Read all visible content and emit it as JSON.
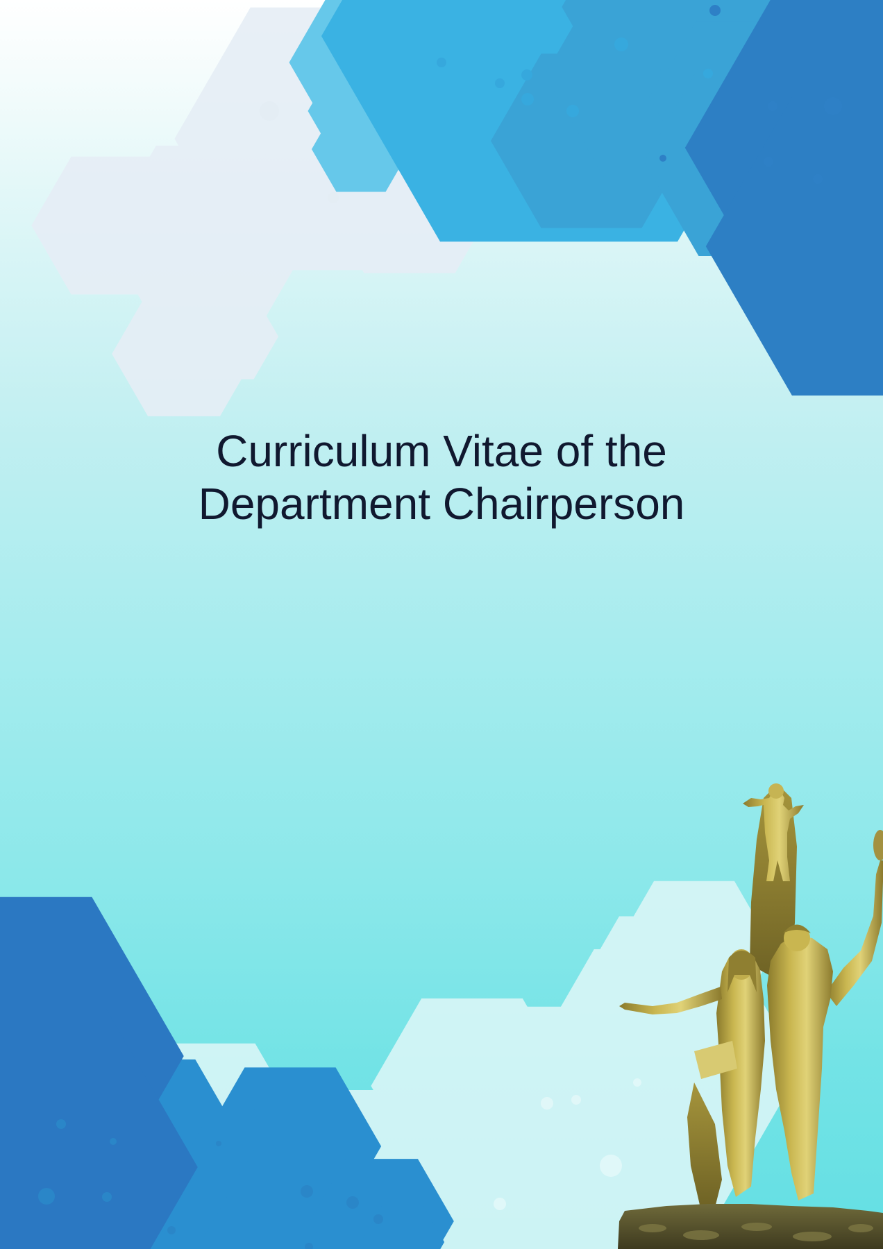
{
  "document": {
    "title_line_1": "Curriculum Vitae of the",
    "title_line_2": "Department Chairperson"
  },
  "colors": {
    "title": "#10182f",
    "hex_strong": "#2f86c8",
    "hex_light": "#4ec3e8",
    "statue_gold": "#b9a443"
  },
  "decorations": {
    "pattern": "hexagon-molecule-pattern",
    "statue": "monument-statue-image"
  }
}
